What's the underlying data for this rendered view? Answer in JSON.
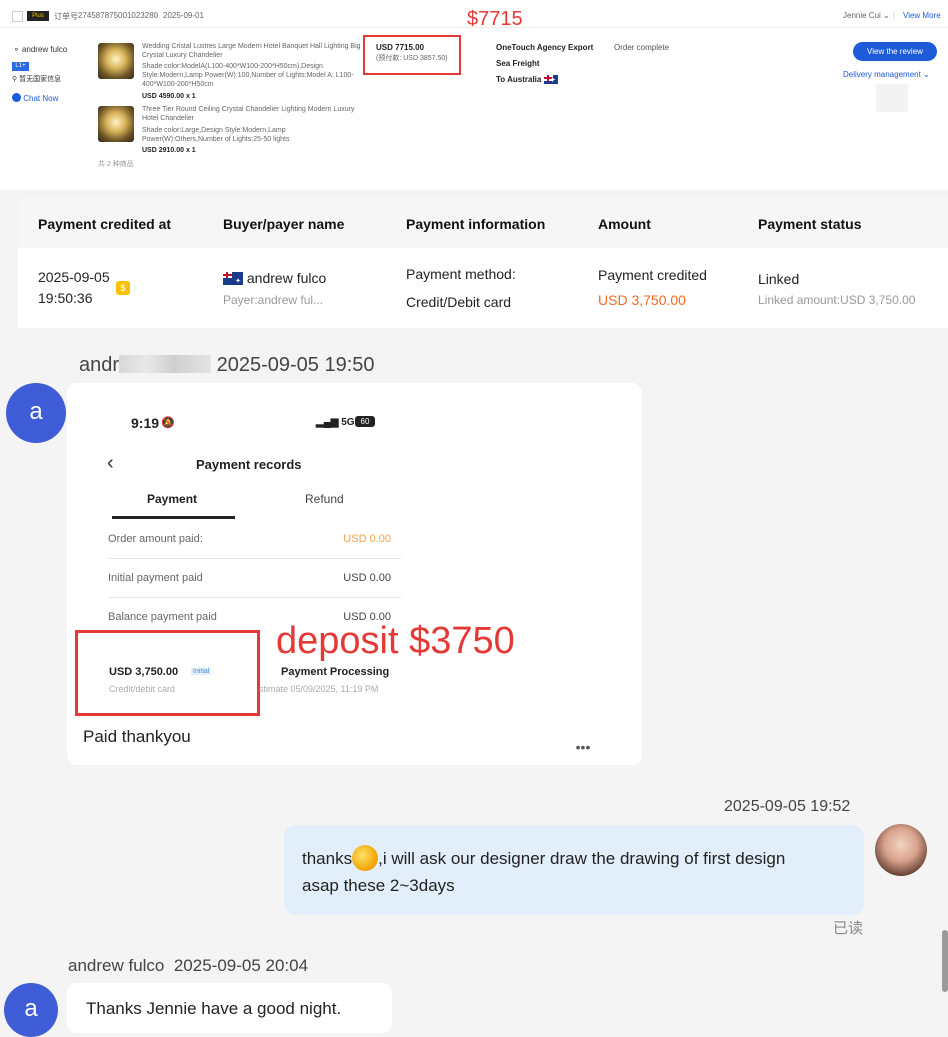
{
  "order": {
    "order_no_label": "订单号",
    "order_no": "274587875001023280",
    "date": "2025-09-01",
    "user": "Jennie Cui",
    "view_more": "View More",
    "buyer_name": "andrew fulco",
    "buyer_level": "L1+",
    "buyer_country_note": "暂无国家信息",
    "chat_now": "Chat Now",
    "items": [
      {
        "title": "Wedding Cristal Lustres Large Modern Hotel Banquet Hall Lighting Big Crystal Luxury Chandelier",
        "specs": "Shade color:ModelA(L100-400*W100-200*H50cm),Design Style:Modern,Lamp Power(W):100,Number of Lights:Model A: L100-400*W100-200*H50cm",
        "price": "USD 4590.00 x 1"
      },
      {
        "title": "Three Tier Round Ceiling Crystal Chandelier Lighting Modern Luxury Hotel Chandelier",
        "specs": "Shade color:Large,Design Style:Modern,Lamp Power(W):Others,Number of Lights:25-50 lights",
        "price": "USD 2910.00 x 1"
      }
    ],
    "items_count": "共 2 种商品",
    "total": "USD 7715.00",
    "paid_note": "(预付款: USD 3857.50)",
    "annotation_total": "$7715",
    "shipping_agent": "OneTouch Agency Export",
    "shipping_method": "Sea Freight",
    "destination": "To Australia",
    "status": "Order complete",
    "review_btn": "View the review",
    "delivery_mgmt": "Delivery management"
  },
  "payment_table": {
    "headers": [
      "Payment credited at",
      "Buyer/payer name",
      "Payment information",
      "Amount",
      "Payment status"
    ],
    "row": {
      "date": "2025-09-05",
      "time": "19:50:36",
      "buyer": "andrew fulco",
      "payer": "Payer:andrew ful...",
      "method_label": "Payment method:",
      "method": "Credit/Debit card",
      "amount_label": "Payment credited",
      "amount": "USD 3,750.00",
      "status": "Linked",
      "linked": "Linked amount:USD 3,750.00"
    }
  },
  "chat": {
    "msg1": {
      "avatar": "a",
      "sender_visible": "andr",
      "time": "2025-09-05 19:50",
      "text": "Paid thankyou",
      "screenshot": {
        "clock": "9:19",
        "network": "5G",
        "battery": "60",
        "title": "Payment records",
        "tab_active": "Payment",
        "tab_other": "Refund",
        "rows": [
          {
            "label": "Order amount paid:",
            "value": "USD 0.00"
          },
          {
            "label": "Initial payment paid",
            "value": "USD 0.00"
          },
          {
            "label": "Balance payment paid",
            "value": "USD 0.00"
          }
        ],
        "entry_amount": "USD 3,750.00",
        "entry_tag": "Initial",
        "entry_method": "Credit/debit card",
        "entry_status": "Payment Processing",
        "entry_estimate": "stimate 05/09/2025, 11:19 PM"
      },
      "annotation": "deposit $3750"
    },
    "msg2": {
      "time": "2025-09-05 19:52",
      "text_before": "thanks",
      "text_after": ",i will ask our designer draw the drawing of first design",
      "text_line2": "asap these 2~3days",
      "read": "已读"
    },
    "msg3": {
      "avatar": "a",
      "sender": "andrew fulco",
      "time": "2025-09-05 20:04",
      "text": "Thanks Jennie have a good night."
    },
    "more": "•••"
  },
  "colors": {
    "accent_blue": "#1d5bd8",
    "annotation_red": "#e53935",
    "amount_orange": "#f26b1d",
    "avatar_blue": "#3f5dd6"
  }
}
